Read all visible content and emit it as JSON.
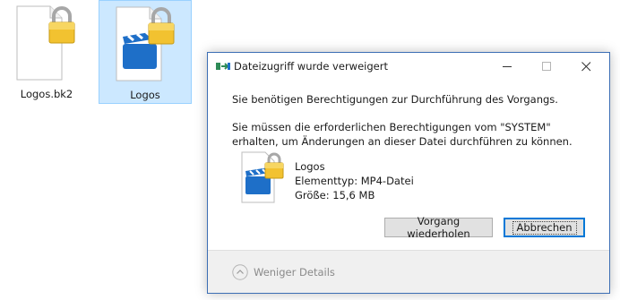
{
  "files": [
    {
      "name": "Logos.bk2",
      "icon": "blank-document-icon",
      "locked": true,
      "selected": false
    },
    {
      "name": "Logos",
      "icon": "video-clapperboard-icon",
      "locked": true,
      "selected": true
    }
  ],
  "dialog": {
    "title": "Dateizugriff wurde verweigert",
    "message": "Sie benötigen Berechtigungen zur Durchführung des Vorgangs.",
    "detail": "Sie müssen die erforderlichen Berechtigungen vom \"SYSTEM\" erhalten, um Änderungen an dieser Datei durchführen zu können.",
    "item": {
      "name": "Logos",
      "type": "Elementtyp: MP4-Datei",
      "size": "Größe: 15,6 MB"
    },
    "buttons": {
      "retry": "Vorgang wiederholen",
      "cancel": "Abbrechen"
    },
    "footer": {
      "toggle": "Weniger Details"
    }
  },
  "colors": {
    "selection_bg": "#cce8ff",
    "selection_border": "#99d1ff",
    "dialog_border": "#3c6eb4",
    "clapper_blue": "#1e6fc8",
    "lock_gold": "#e8b923",
    "focus_blue": "#0078d7"
  }
}
